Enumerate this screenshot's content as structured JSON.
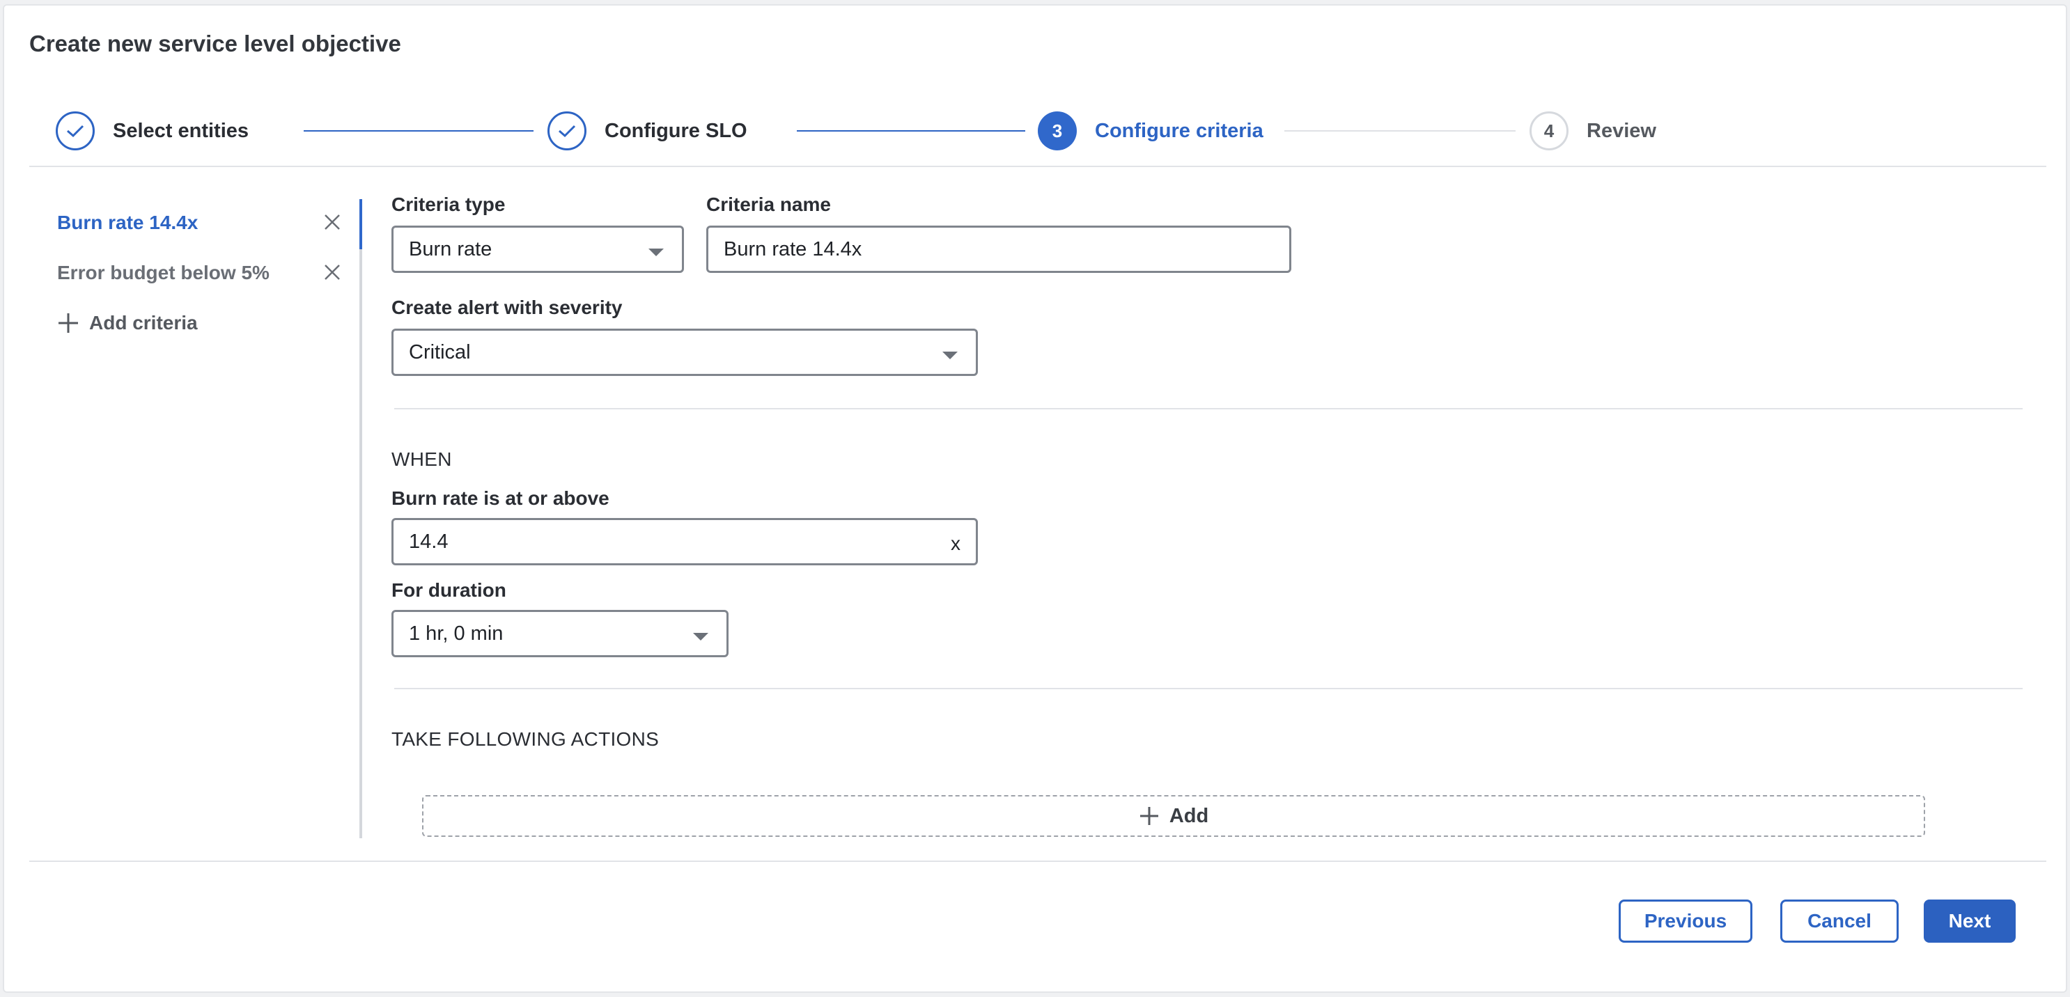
{
  "dialog": {
    "title": "Create new service level objective"
  },
  "stepper": {
    "steps": [
      {
        "label": "Select entities",
        "state": "done"
      },
      {
        "label": "Configure SLO",
        "state": "done"
      },
      {
        "number": "3",
        "label": "Configure criteria",
        "state": "active"
      },
      {
        "number": "4",
        "label": "Review",
        "state": "todo"
      }
    ]
  },
  "criteria_list": {
    "items": [
      {
        "label": "Burn rate 14.4x",
        "active": true
      },
      {
        "label": "Error budget below 5%",
        "active": false
      }
    ],
    "add_label": "Add criteria"
  },
  "form": {
    "criteria_type": {
      "label": "Criteria type",
      "value": "Burn rate"
    },
    "criteria_name": {
      "label": "Criteria name",
      "value": "Burn rate 14.4x"
    },
    "severity": {
      "label": "Create alert with severity",
      "value": "Critical"
    },
    "when_heading": "WHEN",
    "burn_rate": {
      "label": "Burn rate is at or above",
      "value": "14.4",
      "clear": "x"
    },
    "duration": {
      "label": "For duration",
      "value": "1 hr, 0 min"
    },
    "actions_heading": "TAKE FOLLOWING ACTIONS",
    "add_action_label": "Add"
  },
  "footer": {
    "previous_label": "Previous",
    "cancel_label": "Cancel",
    "next_label": "Next"
  },
  "colors": {
    "accent": "#2d64c4",
    "primary_button": "#2c61c0",
    "border": "#80858d"
  }
}
